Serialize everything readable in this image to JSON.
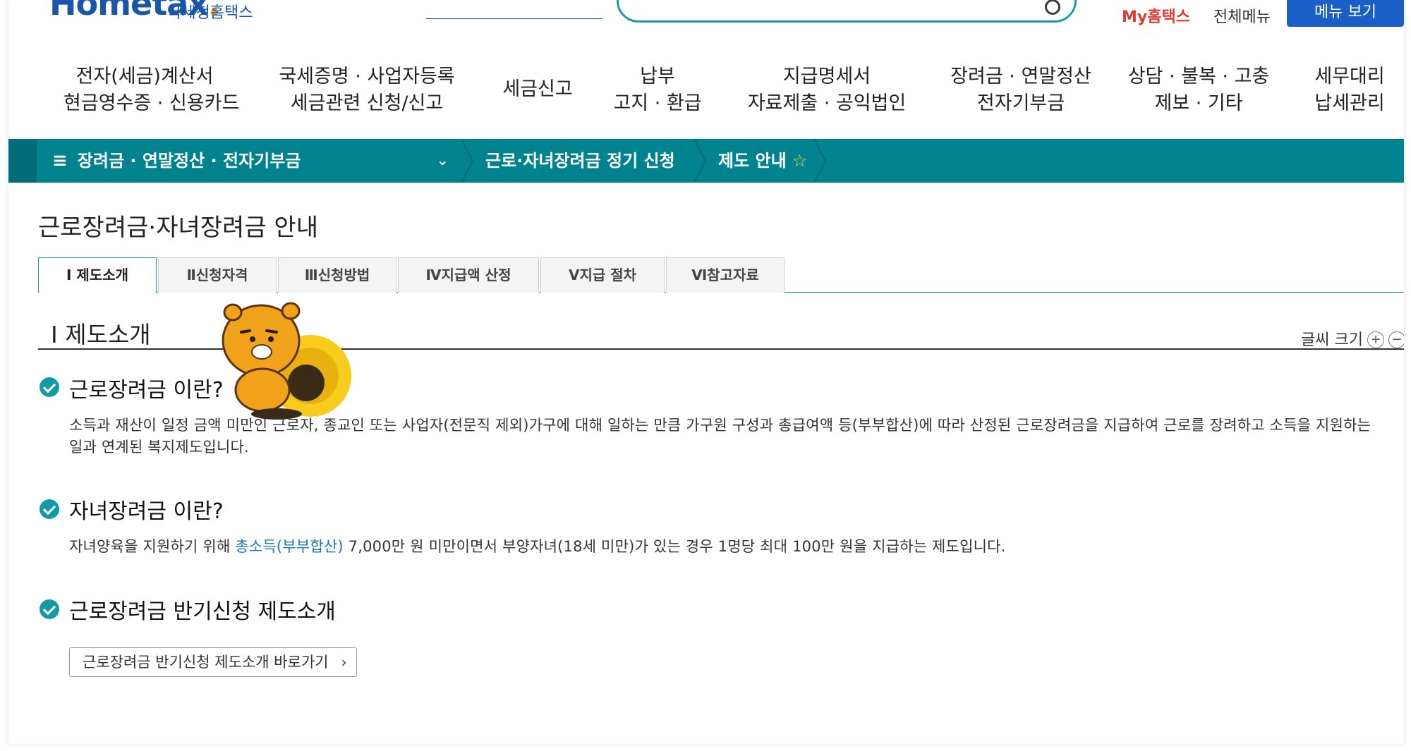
{
  "header": {
    "logo_text": "Hometax",
    "logo_dot": ".",
    "logo_sub": "국세청홈택스",
    "my_hometax": "My홈택스",
    "all_menu": "전체메뉴",
    "menu_view": "메뉴 보기"
  },
  "gnb": [
    {
      "line1": "전자(세금)계산서",
      "line2": "현금영수증 · 신용카드"
    },
    {
      "line1": "국세증명 · 사업자등록",
      "line2": "세금관련 신청/신고"
    },
    {
      "line1": "세금신고",
      "line2": ""
    },
    {
      "line1": "납부",
      "line2": "고지 · 환급"
    },
    {
      "line1": "지급명세서",
      "line2": "자료제출 · 공익법인"
    },
    {
      "line1": "장려금 · 연말정산",
      "line2": "전자기부금"
    },
    {
      "line1": "상담 · 불복 · 고충",
      "line2": "제보 · 기타"
    },
    {
      "line1": "세무대리",
      "line2": "납세관리"
    }
  ],
  "location": {
    "hamburger": "≡",
    "level1": "장려금 · 연말정산 · 전자기부금",
    "level2": "근로·자녀장려금 정기 신청",
    "level3": "제도 안내",
    "chevron": "⌄",
    "star": "☆"
  },
  "page_title": "근로장려금·자녀장려금 안내",
  "tabs": [
    {
      "label": "Ⅰ 제도소개",
      "active": true
    },
    {
      "label": "Ⅱ신청자격",
      "active": false
    },
    {
      "label": "Ⅲ신청방법",
      "active": false
    },
    {
      "label": "Ⅳ지급액 산정",
      "active": false
    },
    {
      "label": "Ⅴ지급 절차",
      "active": false
    },
    {
      "label": "Ⅵ참고자료",
      "active": false
    }
  ],
  "section": {
    "title": "Ⅰ 제도소개",
    "font_size_label": "글씨 크기",
    "plus": "+",
    "minus": "−"
  },
  "blocks": {
    "b1_title": "근로장려금 이란?",
    "b1_body": "소득과 재산이 일정 금액 미만인 근로자, 종교인 또는 사업자(전문직 제외)가구에 대해 일하는 만큼 가구원 구성과 총급여액 등(부부합산)에 따라 산정된 근로장려금을 지급하여 근로를 장려하고 소득을 지원하는 일과 연계된 복지제도입니다.",
    "b2_title": "자녀장려금 이란?",
    "b2_body_pre": "자녀양육을 지원하기 위해 ",
    "b2_body_hl": "총소득(부부합산)",
    "b2_body_post": " 7,000만 원 미만이면서 부양자녀(18세 미만)가 있는 경우 1명당 최대 100만 원을 지급하는 제도입니다.",
    "b3_title": "근로장려금 반기신청 제도소개",
    "b3_button": "근로장려금 반기신청 제도소개 바로가기",
    "b3_button_arrow": "›"
  },
  "colors": {
    "teal": "#00838f",
    "check": "#139aa8",
    "brand_blue": "#1a5fc8",
    "my_red": "#e23a2e",
    "mascot": "#f0a21a"
  }
}
